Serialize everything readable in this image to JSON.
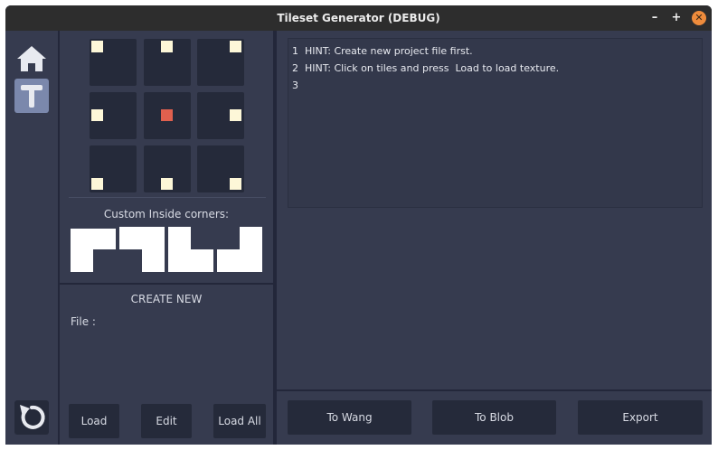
{
  "window": {
    "title": "Tileset Generator (DEBUG)",
    "minimize_label": "–",
    "maximize_label": "+",
    "close_label": "✕"
  },
  "sidebar": {
    "items": [
      {
        "name": "home",
        "icon": "home-icon"
      },
      {
        "name": "tiles",
        "icon": "text-t-icon",
        "selected": true
      },
      {
        "name": "refresh",
        "icon": "refresh-icon"
      }
    ]
  },
  "tile_grid": {
    "dots": [
      "top-left",
      "top-center",
      "top-right",
      "middle-left",
      "center",
      "middle-right",
      "bottom-left",
      "bottom-center",
      "bottom-right"
    ],
    "center_color": "#e0604e"
  },
  "corners": {
    "label": "Custom Inside corners:"
  },
  "create": {
    "title": "CREATE NEW",
    "file_label": "File  :",
    "buttons": {
      "load": "Load",
      "edit": "Edit",
      "load_all": "Load All"
    }
  },
  "editor": {
    "lines": [
      {
        "no": "1",
        "text": "HINT: Create new project file first."
      },
      {
        "no": "2",
        "text": "HINT: Click on tiles and press  Load to load texture."
      },
      {
        "no": "3",
        "text": ""
      }
    ]
  },
  "actions": {
    "to_wang": "To Wang",
    "to_blob": "To Blob",
    "export": "Export"
  },
  "colors": {
    "background": "#363b4f",
    "tile": "#252a3a",
    "accent": "#e0604e",
    "dot": "#fdf7d8",
    "selected_sidebar": "#7b88ac"
  }
}
